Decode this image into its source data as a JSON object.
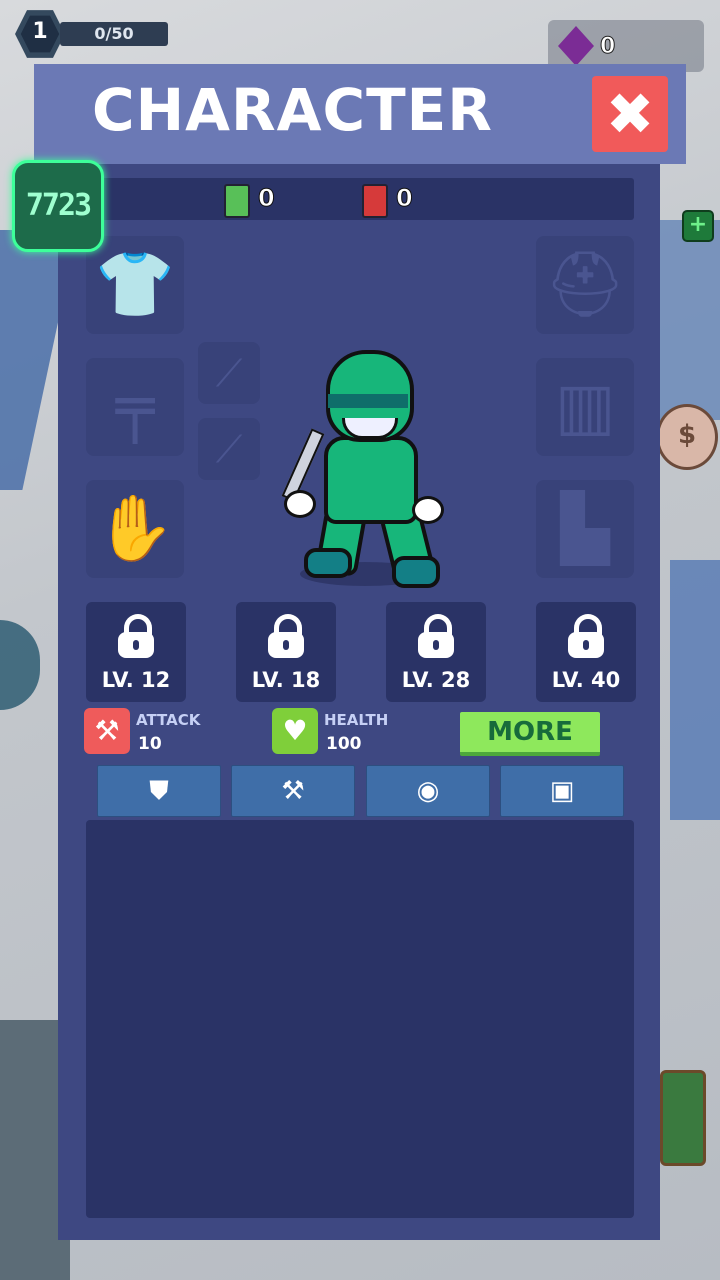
{
  "hud": {
    "level": "1",
    "xp": "0/50",
    "gems": "0",
    "coins": "7723",
    "plus": "+",
    "piggy": "$"
  },
  "panel": {
    "title": "CHARACTER",
    "close": "✖",
    "green_cash": "0",
    "red_cash": "0"
  },
  "locked_slots": [
    {
      "label": "LV. 12"
    },
    {
      "label": "LV. 18"
    },
    {
      "label": "LV. 28"
    },
    {
      "label": "LV. 40"
    }
  ],
  "stats": {
    "attack_label": "ATTACK",
    "attack_value": "10",
    "health_label": "HEALTH",
    "health_value": "100",
    "more": "MORE"
  },
  "equipment_slots": [
    "shirt-icon",
    "helmet-icon",
    "rifle-icon",
    "shovel-icon",
    "whip-icon",
    "vest-icon",
    "glove-icon",
    "boot-icon"
  ],
  "tabs": [
    "armor-tab-icon",
    "axe-tab-icon",
    "pet-tab-icon",
    "chest-tab-icon"
  ],
  "colors": {
    "panel": "#3e4882",
    "title_bar": "#6b79b5",
    "close": "#f15a5a",
    "more": "#8ee85c",
    "tab": "#3f6ea8"
  }
}
